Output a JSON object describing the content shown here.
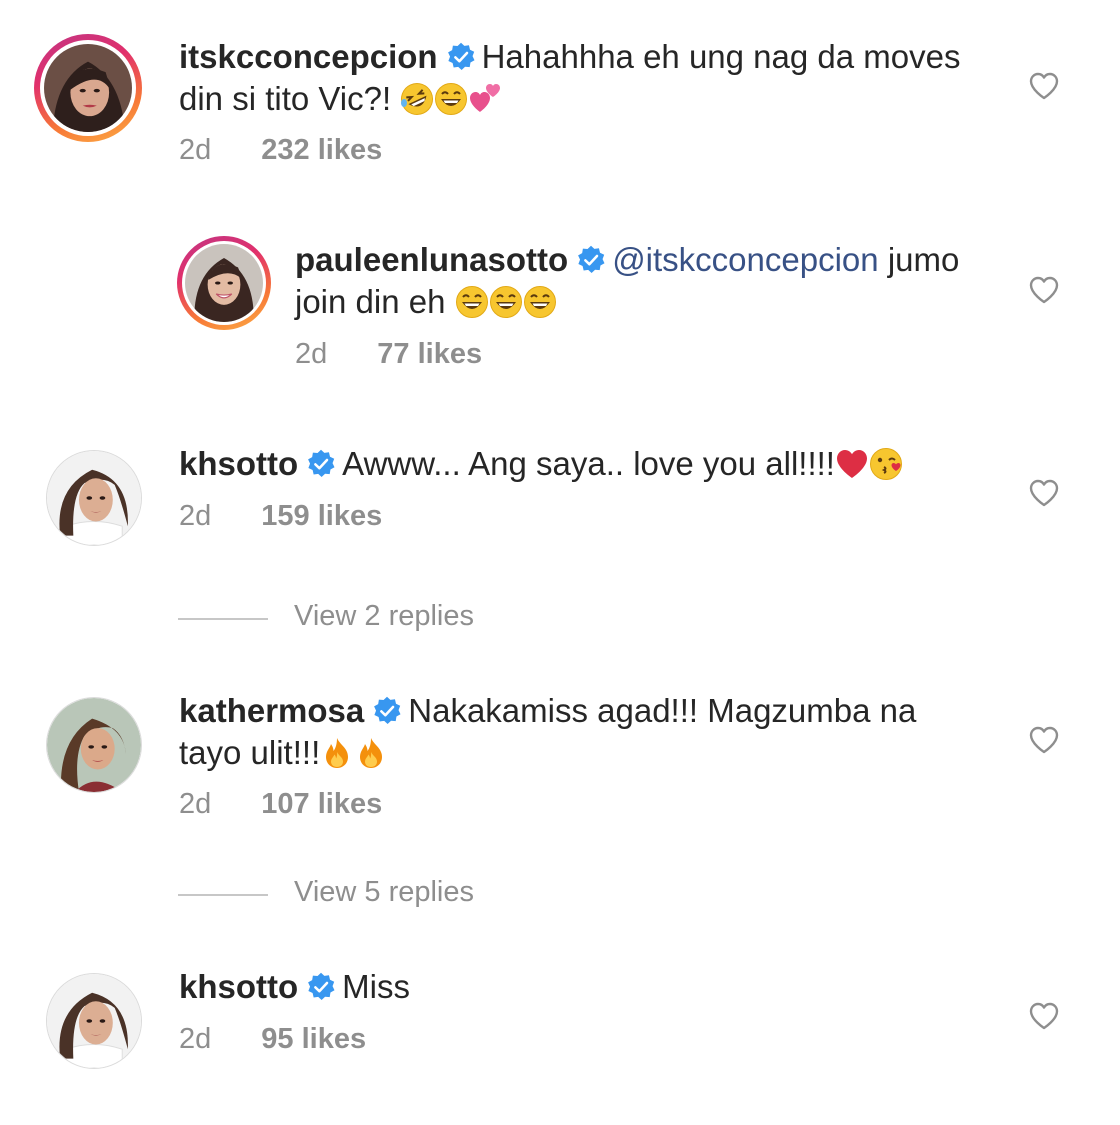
{
  "comments": [
    {
      "user": "itskcconcepcion",
      "line1": "Hahahhha eh ung nag da moves",
      "line2": "din si tito Vic?!",
      "time": "2d",
      "likes": "232 likes"
    },
    {
      "user": "pauleenlunasotto",
      "mention": "@itskcconcepcion",
      "line1": "jumo",
      "line2": "join din eh",
      "time": "2d",
      "likes": "77 likes"
    },
    {
      "user": "khsotto",
      "line1": "Awww... Ang saya.. love you all!!!!",
      "time": "2d",
      "likes": "159 likes",
      "view_replies": "View 2 replies"
    },
    {
      "user": "kathermosa",
      "line1": "Nakakamiss agad!!! Magzumba na",
      "line2": "tayo ulit!!!",
      "time": "2d",
      "likes": "107 likes",
      "view_replies": "View 5 replies"
    },
    {
      "user": "khsotto",
      "line1": "Miss",
      "time": "2d",
      "likes": "95 likes"
    }
  ],
  "icons": {
    "verified": "verified-badge-icon",
    "like": "heart-outline-icon"
  },
  "colors": {
    "verified": "#3897f0",
    "meta": "#8e8e8e",
    "mention": "#385185"
  }
}
